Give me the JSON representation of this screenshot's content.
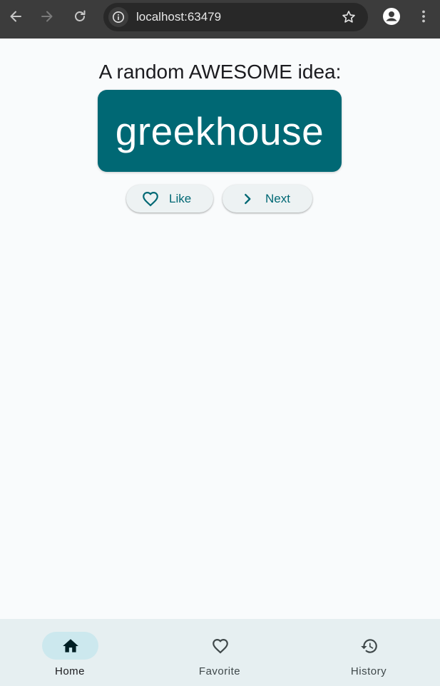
{
  "browser": {
    "url": "localhost:63479",
    "icons": {
      "back": "back-arrow-icon",
      "forward": "forward-arrow-icon",
      "reload": "reload-icon",
      "site_info": "info-icon",
      "bookmark": "star-icon",
      "profile": "account-icon",
      "menu": "more-vert-icon"
    }
  },
  "app": {
    "heading": "A random AWESOME idea:",
    "idea": "greekhouse",
    "buttons": {
      "like_label": "Like",
      "next_label": "Next"
    },
    "colors": {
      "primary": "#006874",
      "surface": "#f9fbfc",
      "nav_background": "#e6eff1",
      "nav_indicator": "#cce8ee"
    }
  },
  "nav": {
    "items": [
      {
        "label": "Home",
        "icon": "home-icon",
        "selected": true
      },
      {
        "label": "Favorite",
        "icon": "heart-outline-icon",
        "selected": false
      },
      {
        "label": "History",
        "icon": "history-icon",
        "selected": false
      }
    ]
  }
}
